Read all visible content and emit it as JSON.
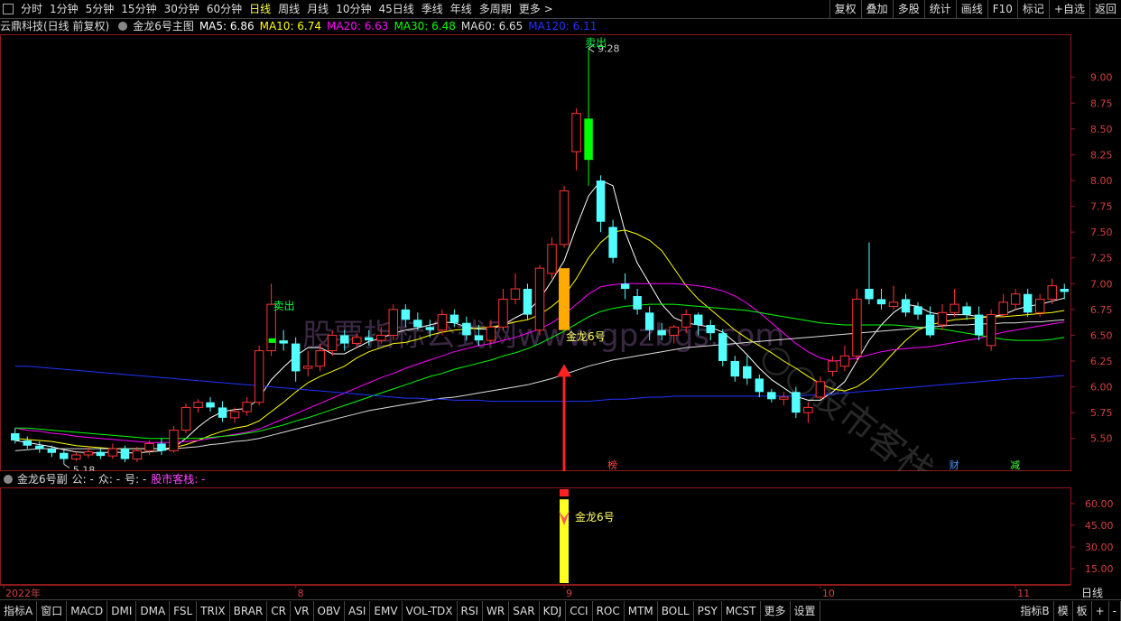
{
  "toolbar": {
    "tabs": [
      "分时",
      "1分钟",
      "5分钟",
      "15分钟",
      "30分钟",
      "60分钟",
      "日线",
      "周线",
      "月线",
      "10分钟",
      "45日线",
      "季线",
      "年线",
      "多周期",
      "更多 >"
    ],
    "active": "日线",
    "right_buttons": [
      "复权",
      "叠加",
      "多股",
      "统计",
      "画线",
      "F10",
      "标记",
      "+自选",
      "返回"
    ]
  },
  "main_header": {
    "stock": "云鼎科技(日线 前复权)",
    "indicator": "金龙6号主图",
    "ma": [
      {
        "label": "MA5: 6.86",
        "color": "#ffffff"
      },
      {
        "label": "MA10: 6.74",
        "color": "#ffff00"
      },
      {
        "label": "MA20: 6.63",
        "color": "#ff00ff"
      },
      {
        "label": "MA30: 6.48",
        "color": "#00ff00"
      },
      {
        "label": "MA60: 6.65",
        "color": "#dddddd"
      },
      {
        "label": "MA120: 6.11",
        "color": "#2233ff"
      }
    ]
  },
  "sub_header": {
    "title": "金龙6号副",
    "fields": [
      "公: -",
      "众: -",
      "号: -"
    ],
    "tag": "股市客栈: -"
  },
  "chart_data": {
    "type": "candlestick",
    "price_axis": {
      "ylim": [
        5.2,
        9.4
      ],
      "ticks": [
        "9.00",
        "8.75",
        "8.50",
        "8.25",
        "8.00",
        "7.75",
        "7.50",
        "7.25",
        "7.00",
        "6.75",
        "6.50",
        "6.25",
        "6.00",
        "5.75",
        "5.50"
      ]
    },
    "sub_axis": {
      "ylim": [
        5,
        70
      ],
      "ticks": [
        "60.00",
        "45.00",
        "30.00",
        "15.00"
      ]
    },
    "date_labels": [
      {
        "label": "2022年",
        "index": 0
      },
      {
        "label": "8",
        "index": 23
      },
      {
        "label": "9",
        "index": 45
      },
      {
        "label": "10",
        "index": 66
      },
      {
        "label": "11",
        "index": 82
      }
    ],
    "period_label": "日线",
    "annotations": {
      "high_label": "9.28",
      "low_label": "5.18",
      "sell_label_1": "卖出",
      "sell_label_2": "卖出",
      "signal_label": "金龙6号",
      "sub_signal_label": "金龙6号",
      "tags": [
        {
          "text": "榜",
          "index": 49,
          "color": "#ff4444"
        },
        {
          "text": "财",
          "index": 77,
          "color": "#4499ff"
        },
        {
          "text": "减",
          "index": 82,
          "color": "#44ff44"
        }
      ]
    },
    "candles": [
      [
        5.55,
        5.48,
        5.6,
        5.45
      ],
      [
        5.48,
        5.43,
        5.52,
        5.4
      ],
      [
        5.43,
        5.4,
        5.47,
        5.36
      ],
      [
        5.4,
        5.36,
        5.43,
        5.32
      ],
      [
        5.36,
        5.3,
        5.39,
        5.25
      ],
      [
        5.3,
        5.34,
        5.37,
        5.28
      ],
      [
        5.34,
        5.37,
        5.42,
        5.31
      ],
      [
        5.37,
        5.33,
        5.4,
        5.3
      ],
      [
        5.33,
        5.4,
        5.45,
        5.3
      ],
      [
        5.4,
        5.3,
        5.43,
        5.27
      ],
      [
        5.3,
        5.38,
        5.42,
        5.27
      ],
      [
        5.38,
        5.45,
        5.48,
        5.34
      ],
      [
        5.45,
        5.38,
        5.5,
        5.34
      ],
      [
        5.38,
        5.58,
        5.62,
        5.36
      ],
      [
        5.58,
        5.8,
        5.84,
        5.55
      ],
      [
        5.8,
        5.85,
        5.88,
        5.75
      ],
      [
        5.85,
        5.8,
        5.9,
        5.76
      ],
      [
        5.8,
        5.7,
        5.86,
        5.66
      ],
      [
        5.7,
        5.76,
        5.8,
        5.65
      ],
      [
        5.76,
        5.85,
        5.9,
        5.72
      ],
      [
        5.85,
        6.35,
        6.4,
        5.82
      ],
      [
        6.35,
        6.8,
        7.0,
        6.3
      ],
      [
        6.45,
        6.42,
        6.55,
        6.35
      ],
      [
        6.42,
        6.15,
        6.48,
        6.05
      ],
      [
        6.18,
        6.2,
        6.35,
        6.1
      ],
      [
        6.2,
        6.35,
        6.42,
        6.15
      ],
      [
        6.35,
        6.5,
        6.55,
        6.3
      ],
      [
        6.5,
        6.42,
        6.55,
        6.35
      ],
      [
        6.42,
        6.48,
        6.52,
        6.38
      ],
      [
        6.48,
        6.45,
        6.55,
        6.4
      ],
      [
        6.45,
        6.5,
        6.58,
        6.42
      ],
      [
        6.5,
        6.75,
        6.8,
        6.45
      ],
      [
        6.75,
        6.65,
        6.8,
        6.58
      ],
      [
        6.65,
        6.58,
        6.72,
        6.55
      ],
      [
        6.58,
        6.55,
        6.65,
        6.48
      ],
      [
        6.55,
        6.7,
        6.75,
        6.5
      ],
      [
        6.7,
        6.62,
        6.75,
        6.58
      ],
      [
        6.62,
        6.5,
        6.68,
        6.45
      ],
      [
        6.5,
        6.45,
        6.6,
        6.4
      ],
      [
        6.45,
        6.58,
        6.65,
        6.42
      ],
      [
        6.58,
        6.85,
        6.95,
        6.55
      ],
      [
        6.85,
        6.95,
        7.1,
        6.8
      ],
      [
        6.95,
        6.7,
        7.0,
        6.65
      ],
      [
        6.55,
        7.15,
        7.18,
        6.5
      ],
      [
        7.1,
        7.38,
        7.45,
        7.05
      ],
      [
        7.38,
        7.9,
        7.95,
        7.35
      ],
      [
        8.28,
        8.65,
        8.7,
        8.1
      ],
      [
        8.6,
        8.2,
        9.28,
        7.95
      ],
      [
        8.0,
        7.6,
        8.05,
        7.5
      ],
      [
        7.55,
        7.25,
        7.62,
        7.2
      ],
      [
        7.0,
        6.95,
        7.1,
        6.85
      ],
      [
        6.88,
        6.75,
        6.95,
        6.7
      ],
      [
        6.72,
        6.55,
        6.78,
        6.45
      ],
      [
        6.55,
        6.5,
        6.62,
        6.45
      ],
      [
        6.5,
        6.58,
        6.6,
        6.42
      ],
      [
        6.58,
        6.7,
        6.75,
        6.52
      ],
      [
        6.7,
        6.6,
        6.72,
        6.5
      ],
      [
        6.6,
        6.52,
        6.65,
        6.45
      ],
      [
        6.52,
        6.25,
        6.56,
        6.2
      ],
      [
        6.25,
        6.1,
        6.3,
        6.05
      ],
      [
        6.2,
        6.08,
        6.3,
        6.02
      ],
      [
        6.08,
        5.95,
        6.12,
        5.9
      ],
      [
        5.95,
        5.88,
        5.98,
        5.85
      ],
      [
        5.88,
        5.9,
        5.95,
        5.82
      ],
      [
        5.95,
        5.75,
        6.0,
        5.7
      ],
      [
        5.75,
        5.8,
        5.85,
        5.65
      ],
      [
        5.9,
        6.05,
        6.1,
        5.88
      ],
      [
        6.15,
        6.25,
        6.3,
        6.1
      ],
      [
        6.2,
        6.3,
        6.4,
        6.15
      ],
      [
        6.3,
        6.85,
        6.95,
        6.25
      ],
      [
        6.95,
        6.85,
        7.4,
        6.8
      ],
      [
        6.85,
        6.8,
        6.95,
        6.75
      ],
      [
        6.78,
        6.82,
        6.98,
        6.75
      ],
      [
        6.85,
        6.72,
        6.9,
        6.68
      ],
      [
        6.78,
        6.7,
        6.82,
        6.65
      ],
      [
        6.7,
        6.5,
        6.78,
        6.48
      ],
      [
        6.6,
        6.72,
        6.8,
        6.55
      ],
      [
        6.72,
        6.8,
        6.95,
        6.68
      ],
      [
        6.78,
        6.7,
        6.82,
        6.65
      ],
      [
        6.7,
        6.5,
        6.78,
        6.45
      ],
      [
        6.4,
        6.7,
        6.75,
        6.35
      ],
      [
        6.7,
        6.82,
        6.9,
        6.68
      ],
      [
        6.8,
        6.9,
        6.95,
        6.75
      ],
      [
        6.9,
        6.72,
        6.95,
        6.68
      ],
      [
        6.72,
        6.85,
        6.9,
        6.68
      ],
      [
        6.85,
        6.98,
        7.05,
        6.8
      ],
      [
        6.95,
        6.92,
        7.0,
        6.85
      ]
    ],
    "series": [
      {
        "name": "MA5",
        "color": "#ffffff",
        "values": [
          5.48,
          5.46,
          5.44,
          5.42,
          5.39,
          5.37,
          5.36,
          5.36,
          5.37,
          5.36,
          5.36,
          5.37,
          5.38,
          5.41,
          5.5,
          5.61,
          5.7,
          5.76,
          5.78,
          5.79,
          5.89,
          6.07,
          6.19,
          6.3,
          6.38,
          6.38,
          6.32,
          6.32,
          6.38,
          6.44,
          6.47,
          6.52,
          6.55,
          6.57,
          6.6,
          6.63,
          6.62,
          6.58,
          6.56,
          6.56,
          6.6,
          6.67,
          6.73,
          6.85,
          7.03,
          7.22,
          7.55,
          7.85,
          8.0,
          7.95,
          7.5,
          7.2,
          7.0,
          6.8,
          6.67,
          6.62,
          6.6,
          6.58,
          6.53,
          6.43,
          6.31,
          6.18,
          6.07,
          5.99,
          5.91,
          5.87,
          5.87,
          5.95,
          6.05,
          6.25,
          6.45,
          6.6,
          6.72,
          6.8,
          6.78,
          6.72,
          6.7,
          6.7,
          6.7,
          6.68,
          6.68,
          6.7,
          6.75,
          6.78,
          6.8,
          6.83,
          6.86
        ]
      },
      {
        "name": "MA10",
        "color": "#ffff00",
        "values": [
          5.5,
          5.49,
          5.48,
          5.47,
          5.45,
          5.43,
          5.42,
          5.41,
          5.4,
          5.4,
          5.4,
          5.4,
          5.4,
          5.41,
          5.44,
          5.48,
          5.53,
          5.57,
          5.6,
          5.62,
          5.67,
          5.76,
          5.85,
          5.95,
          6.04,
          6.1,
          6.15,
          6.2,
          6.28,
          6.34,
          6.38,
          6.42,
          6.43,
          6.46,
          6.5,
          6.53,
          6.55,
          6.56,
          6.57,
          6.58,
          6.6,
          6.63,
          6.65,
          6.7,
          6.78,
          6.88,
          7.05,
          7.25,
          7.4,
          7.5,
          7.52,
          7.48,
          7.42,
          7.32,
          7.15,
          6.98,
          6.85,
          6.75,
          6.65,
          6.55,
          6.47,
          6.4,
          6.33,
          6.25,
          6.18,
          6.1,
          6.03,
          5.98,
          5.96,
          6.0,
          6.08,
          6.2,
          6.33,
          6.45,
          6.55,
          6.6,
          6.63,
          6.65,
          6.66,
          6.67,
          6.68,
          6.68,
          6.69,
          6.7,
          6.71,
          6.72,
          6.74
        ]
      },
      {
        "name": "MA20",
        "color": "#ff00ff",
        "values": [
          5.6,
          5.58,
          5.57,
          5.55,
          5.54,
          5.52,
          5.51,
          5.5,
          5.49,
          5.48,
          5.47,
          5.46,
          5.46,
          5.46,
          5.47,
          5.48,
          5.5,
          5.52,
          5.54,
          5.56,
          5.59,
          5.64,
          5.69,
          5.74,
          5.79,
          5.84,
          5.89,
          5.94,
          5.99,
          6.04,
          6.09,
          6.13,
          6.18,
          6.22,
          6.26,
          6.3,
          6.34,
          6.37,
          6.4,
          6.42,
          6.45,
          6.48,
          6.52,
          6.56,
          6.62,
          6.7,
          6.8,
          6.9,
          6.97,
          6.99,
          7.0,
          7.0,
          7.0,
          7.0,
          7.0,
          6.99,
          6.98,
          6.96,
          6.93,
          6.88,
          6.81,
          6.72,
          6.62,
          6.52,
          6.42,
          6.34,
          6.28,
          6.25,
          6.26,
          6.28,
          6.31,
          6.34,
          6.36,
          6.37,
          6.38,
          6.39,
          6.41,
          6.43,
          6.45,
          6.47,
          6.5,
          6.53,
          6.55,
          6.57,
          6.59,
          6.61,
          6.63
        ]
      },
      {
        "name": "MA30",
        "color": "#00ff00",
        "values": [
          5.6,
          5.6,
          5.59,
          5.58,
          5.57,
          5.56,
          5.55,
          5.54,
          5.53,
          5.52,
          5.51,
          5.5,
          5.5,
          5.5,
          5.5,
          5.5,
          5.51,
          5.52,
          5.53,
          5.55,
          5.57,
          5.6,
          5.63,
          5.67,
          5.7,
          5.74,
          5.78,
          5.82,
          5.86,
          5.9,
          5.94,
          5.98,
          6.02,
          6.06,
          6.1,
          6.13,
          6.17,
          6.2,
          6.23,
          6.26,
          6.3,
          6.33,
          6.37,
          6.42,
          6.48,
          6.54,
          6.61,
          6.68,
          6.73,
          6.76,
          6.78,
          6.79,
          6.8,
          6.8,
          6.8,
          6.79,
          6.78,
          6.77,
          6.76,
          6.75,
          6.74,
          6.72,
          6.7,
          6.68,
          6.66,
          6.64,
          6.62,
          6.61,
          6.6,
          6.6,
          6.6,
          6.6,
          6.6,
          6.59,
          6.58,
          6.57,
          6.56,
          6.54,
          6.52,
          6.5,
          6.48,
          6.46,
          6.45,
          6.45,
          6.45,
          6.46,
          6.48
        ]
      },
      {
        "name": "MA60",
        "color": "#dddddd",
        "values": [
          5.38,
          5.39,
          5.4,
          5.4,
          5.4,
          5.4,
          5.4,
          5.4,
          5.4,
          5.4,
          5.4,
          5.4,
          5.4,
          5.4,
          5.41,
          5.42,
          5.44,
          5.45,
          5.47,
          5.48,
          5.5,
          5.53,
          5.56,
          5.59,
          5.62,
          5.65,
          5.68,
          5.71,
          5.74,
          5.77,
          5.79,
          5.81,
          5.83,
          5.85,
          5.87,
          5.89,
          5.9,
          5.92,
          5.94,
          5.96,
          5.98,
          6.0,
          6.02,
          6.05,
          6.08,
          6.12,
          6.16,
          6.2,
          6.23,
          6.26,
          6.28,
          6.3,
          6.32,
          6.34,
          6.36,
          6.38,
          6.39,
          6.4,
          6.41,
          6.42,
          6.43,
          6.44,
          6.45,
          6.46,
          6.47,
          6.48,
          6.49,
          6.5,
          6.51,
          6.52,
          6.53,
          6.54,
          6.55,
          6.56,
          6.57,
          6.58,
          6.59,
          6.6,
          6.6,
          6.61,
          6.61,
          6.62,
          6.62,
          6.63,
          6.63,
          6.64,
          6.65
        ]
      },
      {
        "name": "MA120",
        "color": "#2233ff",
        "values": [
          6.2,
          6.2,
          6.19,
          6.18,
          6.17,
          6.16,
          6.15,
          6.14,
          6.13,
          6.12,
          6.11,
          6.1,
          6.09,
          6.08,
          6.07,
          6.06,
          6.05,
          6.04,
          6.03,
          6.02,
          6.01,
          6.0,
          5.99,
          5.98,
          5.97,
          5.96,
          5.95,
          5.94,
          5.93,
          5.92,
          5.91,
          5.9,
          5.89,
          5.89,
          5.88,
          5.88,
          5.87,
          5.87,
          5.87,
          5.86,
          5.86,
          5.86,
          5.86,
          5.86,
          5.86,
          5.86,
          5.86,
          5.86,
          5.87,
          5.88,
          5.88,
          5.89,
          5.9,
          5.9,
          5.91,
          5.91,
          5.91,
          5.91,
          5.91,
          5.91,
          5.91,
          5.91,
          5.91,
          5.91,
          5.91,
          5.92,
          5.92,
          5.93,
          5.94,
          5.95,
          5.96,
          5.97,
          5.98,
          5.99,
          6.0,
          6.01,
          6.02,
          6.03,
          6.04,
          6.05,
          6.06,
          6.07,
          6.08,
          6.08,
          6.09,
          6.1,
          6.11
        ]
      }
    ],
    "sub_signal": {
      "index": 45,
      "top": 63,
      "bottom": 5
    }
  },
  "watermarks": {
    "w1": "股票指标公式网www.gpzbgs.com",
    "w2": "○○股市客栈"
  },
  "bottom_tabs": [
    "指标A",
    "窗口",
    "MACD",
    "DMI",
    "DMA",
    "FSL",
    "TRIX",
    "BRAR",
    "CR",
    "VR",
    "OBV",
    "ASI",
    "EMV",
    "VOL-TDX",
    "RSI",
    "WR",
    "SAR",
    "KDJ",
    "CCI",
    "ROC",
    "MTM",
    "BOLL",
    "PSY",
    "MCST",
    "更多",
    "设置"
  ],
  "bottom_right": [
    "指标B",
    "模",
    "板",
    "+",
    "-"
  ]
}
